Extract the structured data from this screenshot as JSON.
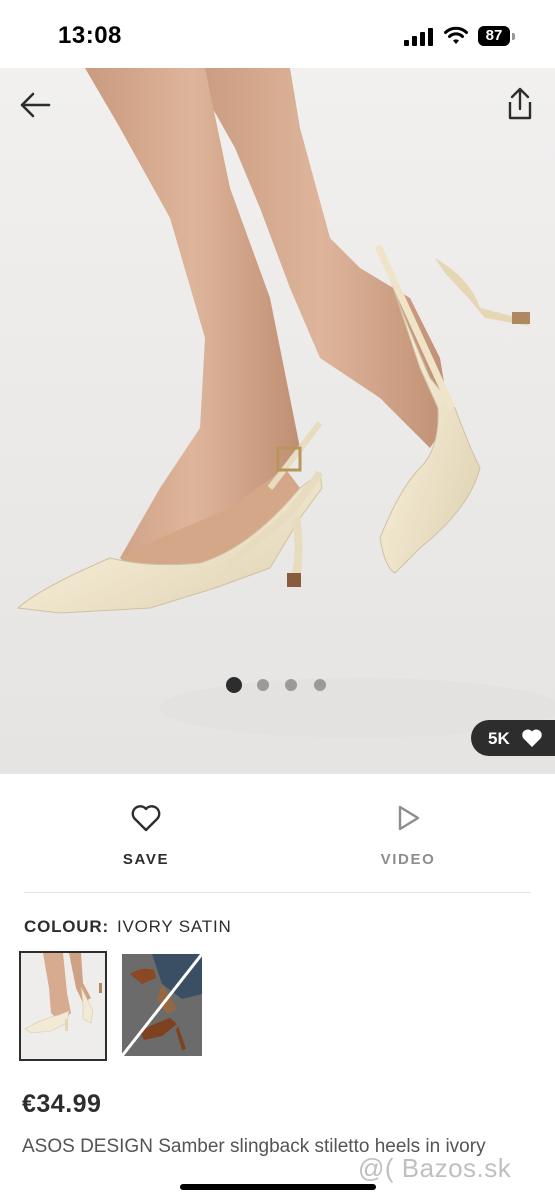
{
  "status_bar": {
    "time": "13:08",
    "battery": "87"
  },
  "gallery": {
    "current_image": 1,
    "image_count": 4,
    "likes": "5K",
    "icons": {
      "back": "arrow-left-icon",
      "share": "share-icon",
      "like": "heart-filled-icon"
    }
  },
  "actions": {
    "save_label": "SAVE",
    "video_label": "VIDEO",
    "icons": {
      "save": "heart-outline-icon",
      "video": "play-icon"
    }
  },
  "colour": {
    "key": "COLOUR:",
    "value": "IVORY SATIN",
    "swatches": [
      {
        "name": "Ivory satin",
        "selected": true
      },
      {
        "name": "Tan",
        "selected": false,
        "unavailable": true
      }
    ]
  },
  "product": {
    "price": "€34.99",
    "title": "ASOS DESIGN Samber slingback stiletto heels in ivory"
  },
  "watermark": "@( Bazos.sk",
  "colors": {
    "text": "#2d2d2d",
    "muted": "#8d8d8d",
    "background": "#ffffff",
    "photo_bg": "#ecebea"
  }
}
